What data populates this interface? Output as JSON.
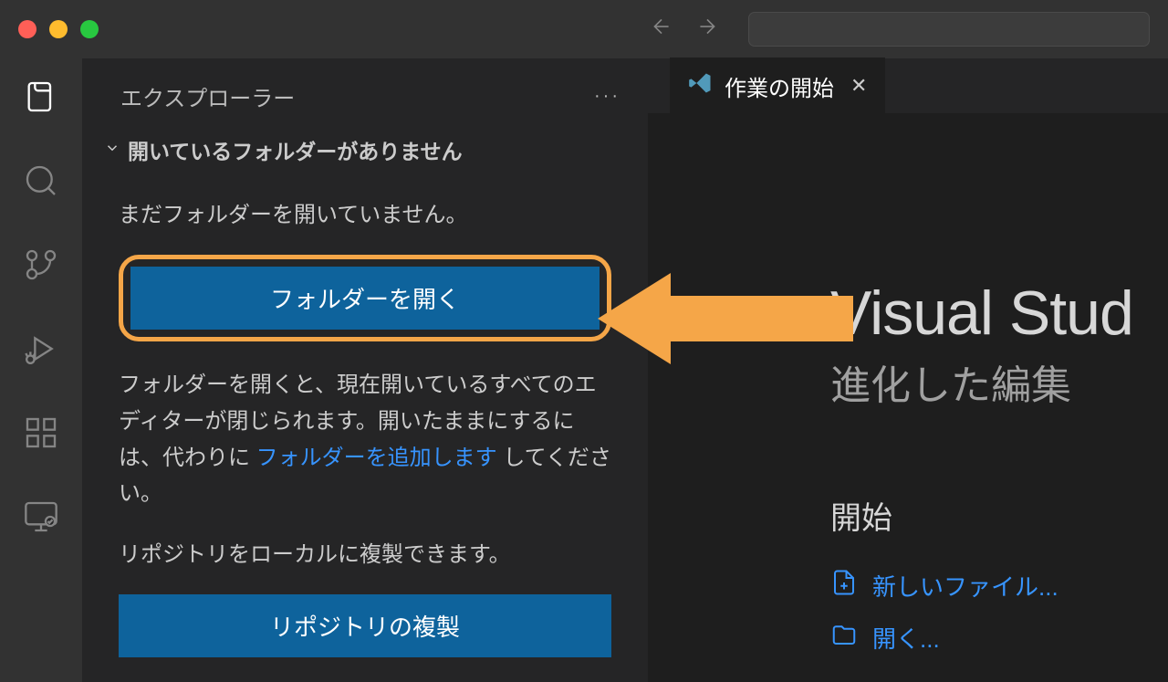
{
  "sidebar": {
    "title": "エクスプローラー",
    "section_header": "開いているフォルダーがありません",
    "no_folder_message": "まだフォルダーを開いていません。",
    "open_folder_button": "フォルダーを開く",
    "description_prefix": "フォルダーを開くと、現在開いているすべてのエディターが閉じられます。開いたままにするには、代わりに ",
    "description_link": "フォルダーを追加します",
    "description_suffix": " してください。",
    "clone_message": "リポジトリをローカルに複製できます。",
    "clone_button": "リポジトリの複製"
  },
  "tab": {
    "label": "作業の開始"
  },
  "welcome": {
    "title": "Visual Stud",
    "subtitle": "進化した編集",
    "start_heading": "開始",
    "new_file": "新しいファイル...",
    "open": "開く..."
  }
}
